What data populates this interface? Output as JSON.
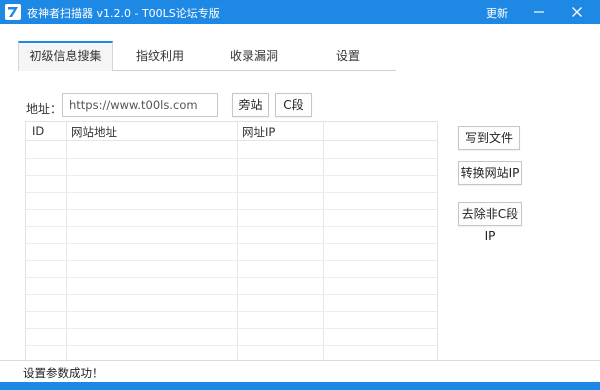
{
  "window": {
    "title": "夜神者扫描器 v1.2.0 - T00LS论坛专版",
    "update_label": "更新",
    "accent_color": "#1e88e5",
    "logo_icon": "app-logo-icon",
    "minimize_icon": "minimize-icon",
    "close_icon": "close-icon"
  },
  "tabs": [
    {
      "label": "初级信息搜集",
      "active": true
    },
    {
      "label": "指纹利用",
      "active": false
    },
    {
      "label": "收录漏洞",
      "active": false
    },
    {
      "label": "设置",
      "active": false
    }
  ],
  "address": {
    "label": "地址：",
    "value": "https://www.t00ls.com",
    "placeholder": ""
  },
  "toolbar": {
    "side_site_label": "旁站",
    "c_segment_label": "C段"
  },
  "table": {
    "columns": [
      "ID",
      "网站地址",
      "网址IP",
      ""
    ],
    "rows": []
  },
  "actions": {
    "write_file_label": "写到文件",
    "convert_ip_label": "转换网站IP",
    "remove_non_c_label": "去除非C段IP"
  },
  "status": {
    "text": "设置参数成功！"
  }
}
